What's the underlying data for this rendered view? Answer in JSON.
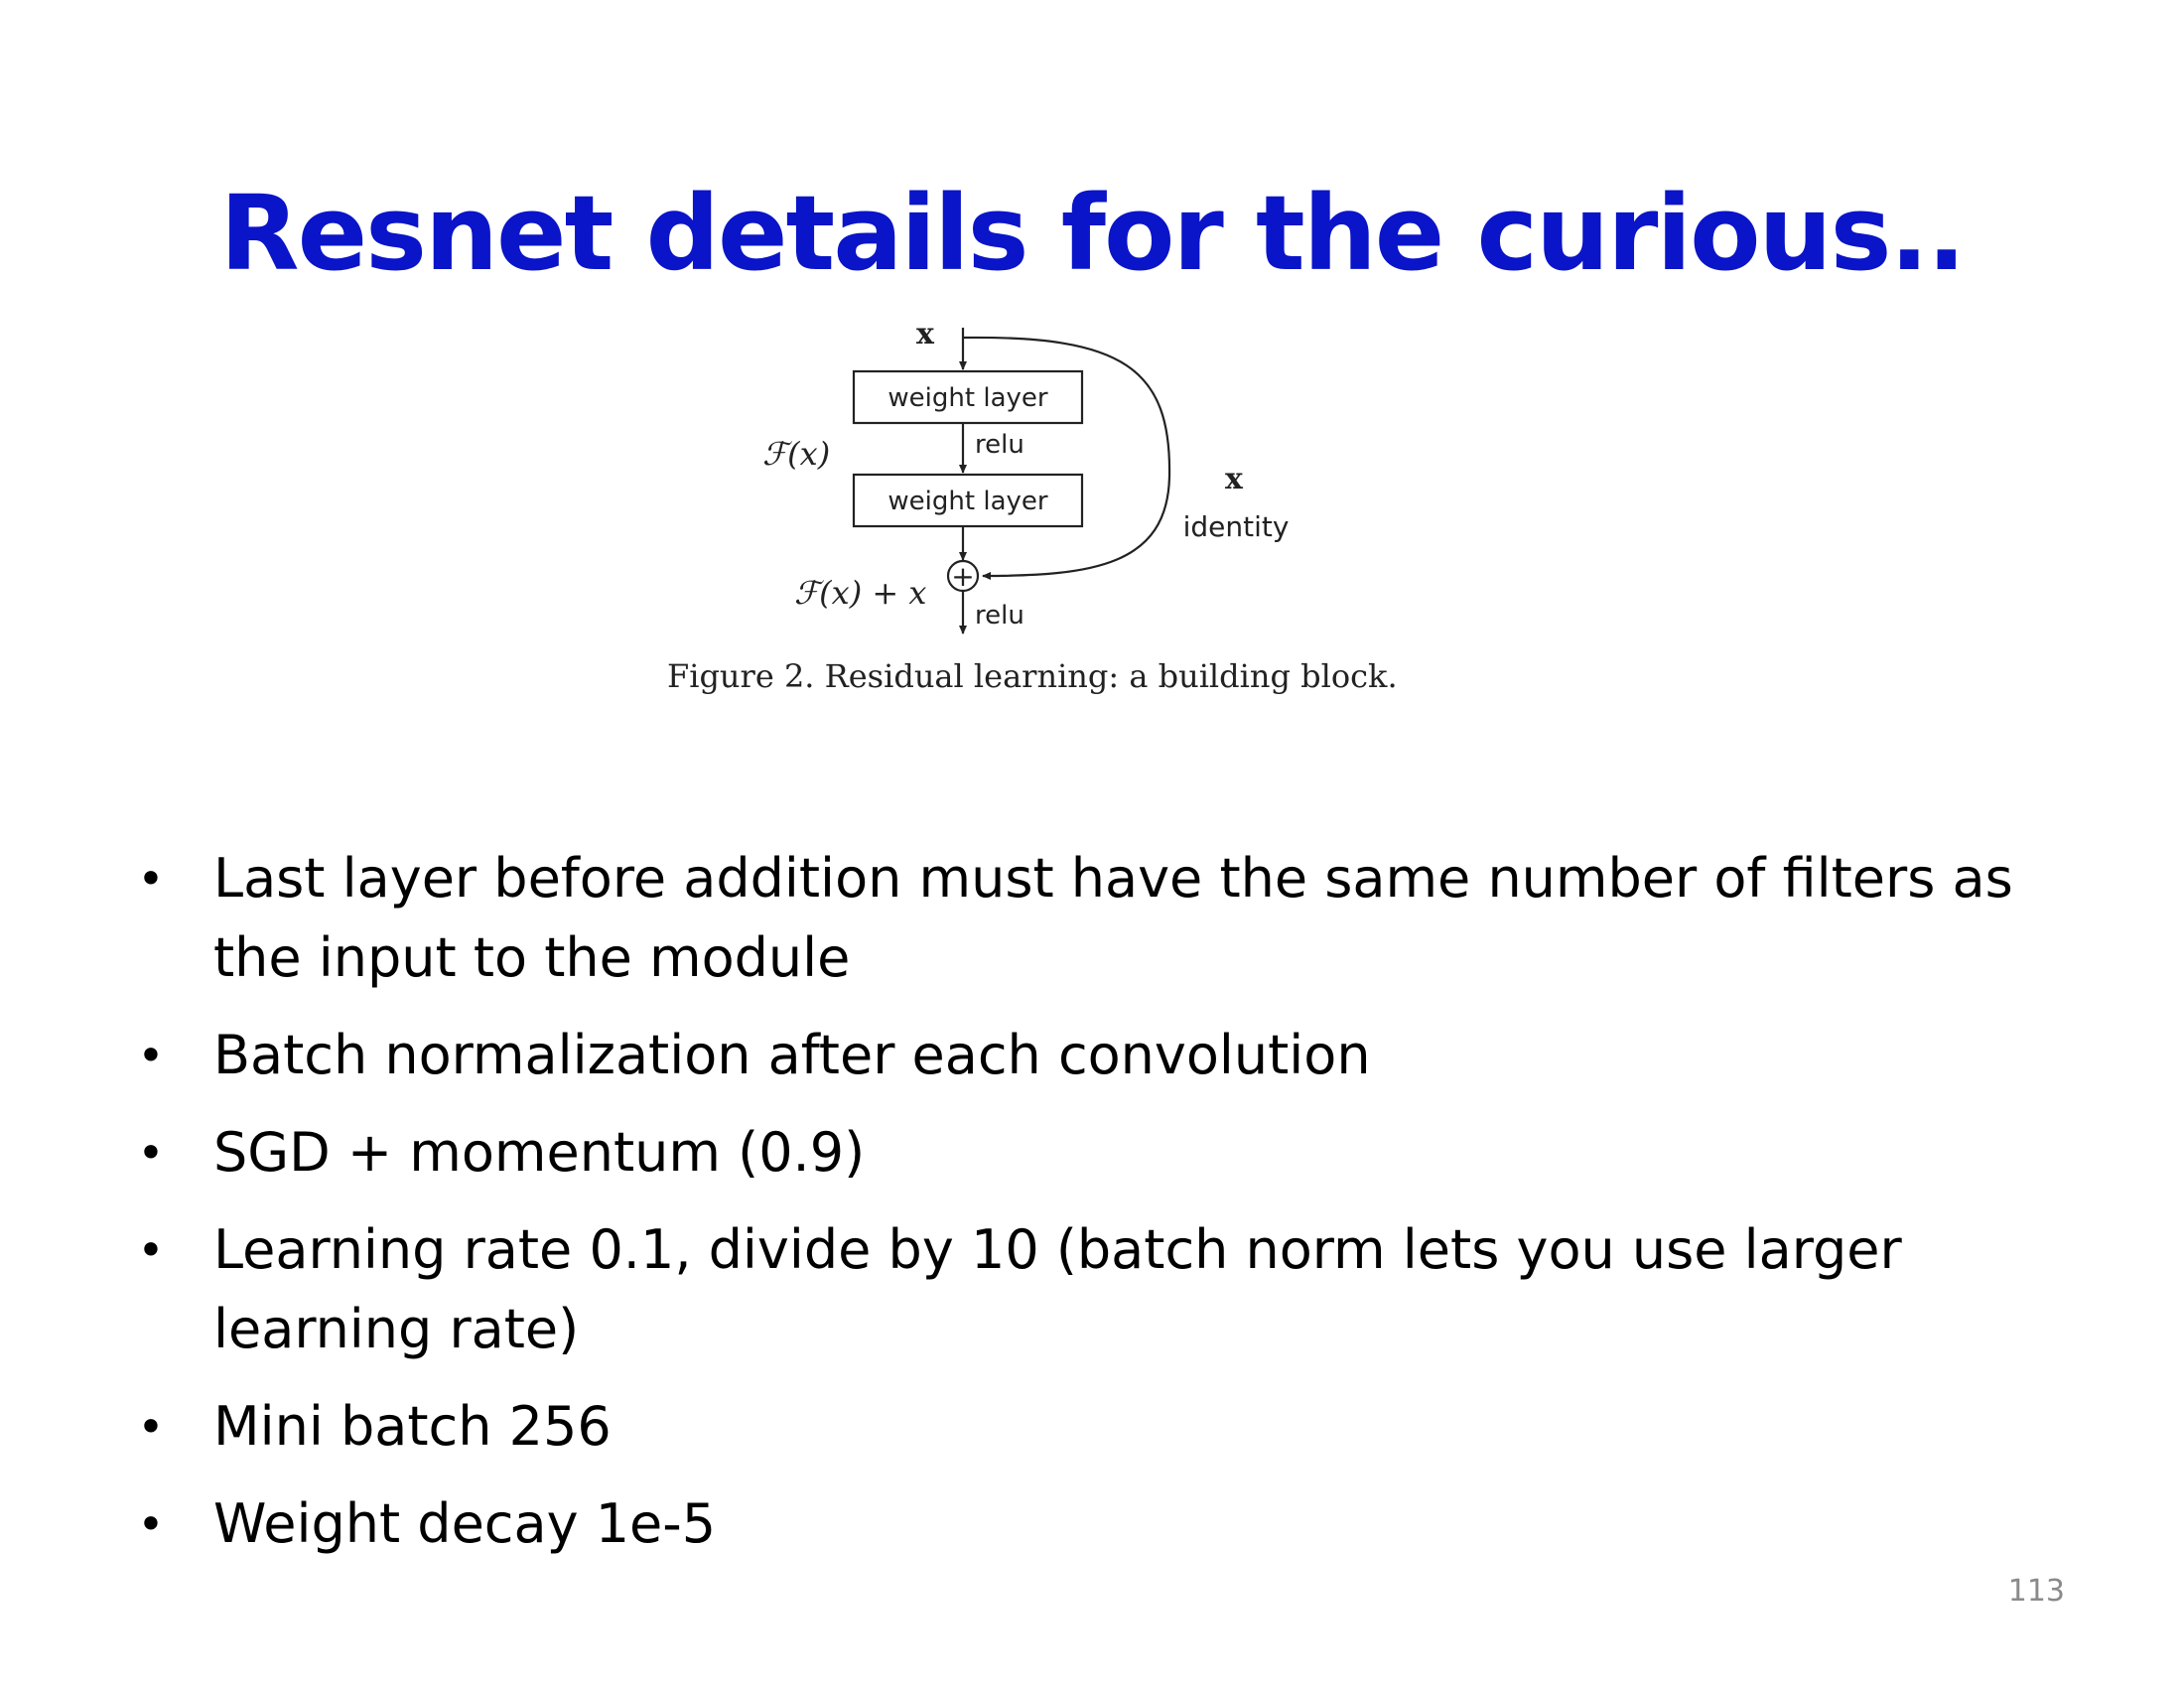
{
  "slide": {
    "title": "Resnet details for the curious..",
    "page_number": "113"
  },
  "figure": {
    "input_label": "x",
    "layer1_label": "weight layer",
    "relu1_label": "relu",
    "layer2_label": "weight layer",
    "function_label": "ℱ(x)",
    "identity_x_label": "x",
    "identity_label": "identity",
    "sum_label": "ℱ(x) + x",
    "plus_symbol": "+",
    "relu2_label": "relu",
    "caption": "Figure 2. Residual learning: a building block."
  },
  "bullets": [
    {
      "text": "Last layer before addition must have the same number of filters as the input to the module"
    },
    {
      "text": "Batch normalization after each convolution"
    },
    {
      "text": "SGD + momentum (0.9)"
    },
    {
      "text": "Learning rate 0.1, divide by 10 (batch norm lets you use larger learning rate)"
    },
    {
      "text": "Mini batch 256"
    },
    {
      "text": "Weight decay 1e-5"
    }
  ],
  "colors": {
    "title": "#0a14c8",
    "body_text": "#000000",
    "page_number": "#8a8a8a"
  }
}
